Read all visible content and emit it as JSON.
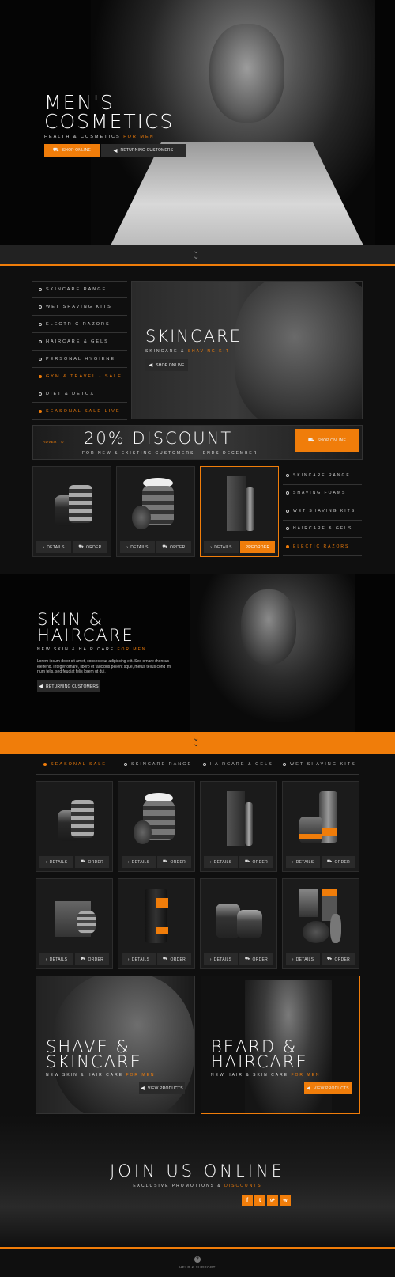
{
  "hero": {
    "title_line1": "MEN'S",
    "title_line2": "COSMETICS",
    "subtitle": "HEALTH & COSMETICS",
    "subtitle_accent": "FOR MEN",
    "btn_shop": "SHOP ONLINE",
    "btn_returning": "RETURNING CUSTOMERS"
  },
  "sidebar": {
    "items": [
      {
        "label": "SKINCARE RANGE",
        "active": false
      },
      {
        "label": "WET SHAVING KITS",
        "active": false
      },
      {
        "label": "ELECTRIC RAZORS",
        "active": false
      },
      {
        "label": "HAIRCARE & GELS",
        "active": false
      },
      {
        "label": "PERSONAL HYGIENE",
        "active": false
      },
      {
        "label": "GYM & TRAVEL - SALE",
        "active": true
      },
      {
        "label": "DIET & DETOX",
        "active": false
      },
      {
        "label": "SEASONAL SALE LIVE",
        "active": true
      }
    ]
  },
  "skincare": {
    "title": "SKINCARE",
    "subtitle": "SKINCARE &",
    "subtitle_accent": "SHAVING KIT",
    "btn": "SHOP ONLINE"
  },
  "discount": {
    "tag": "ADVERT",
    "title": "20% DISCOUNT",
    "subtitle": "FOR NEW & EXISTING CUSTOMERS - ENDS DECEMBER",
    "btn": "SHOP ONLINE"
  },
  "cards_top": [
    {
      "details": "DETAILS",
      "action": "ORDER",
      "highlight": false
    },
    {
      "details": "DETAILS",
      "action": "ORDER",
      "highlight": false
    },
    {
      "details": "DETAILS",
      "action": "PREORDER",
      "highlight": true
    }
  ],
  "side_list": [
    {
      "label": "SKINCARE RANGE",
      "active": false
    },
    {
      "label": "SHAVING FOAMS",
      "active": false
    },
    {
      "label": "WET SHAVING KITS",
      "active": false
    },
    {
      "label": "HAIRCARE & GELS",
      "active": false
    },
    {
      "label": "ELECTIC RAZORS",
      "active": true
    }
  ],
  "haircare": {
    "title_line1": "SKIN &",
    "title_line2": "HAIRCARE",
    "subtitle": "NEW SKIN & HAIR CARE",
    "subtitle_accent": "FOR MEN",
    "body": "Lorem ipsum dolor sit amet, consectetur adipiscing elit. Sed ornare rhoncus eleifend. Integer ornare, libero et faucibus pellent sque, metus tellus cond im rtum felis, sed feugiat felis lorem ut dui.",
    "btn": "RETURNING CUSTOMERS"
  },
  "tabs": [
    {
      "label": "SEASONAL SALE",
      "active": true
    },
    {
      "label": "SKINCARE RANGE",
      "active": false
    },
    {
      "label": "HAIRCARE & GELS",
      "active": false
    },
    {
      "label": "WET SHAVING KITS",
      "active": false
    }
  ],
  "grid_cards": [
    {
      "details": "DETAILS",
      "action": "ORDER"
    },
    {
      "details": "DETAILS",
      "action": "ORDER"
    },
    {
      "details": "DETAILS",
      "action": "ORDER"
    },
    {
      "details": "DETAILS",
      "action": "ORDER"
    },
    {
      "details": "DETAILS",
      "action": "ORDER"
    },
    {
      "details": "DETAILS",
      "action": "ORDER"
    },
    {
      "details": "DETAILS",
      "action": "ORDER"
    },
    {
      "details": "DETAILS",
      "action": "ORDER"
    }
  ],
  "promo_left": {
    "title_line1": "SHAVE &",
    "title_line2": "SKINCARE",
    "subtitle": "NEW SKIN & HAIR CARE",
    "subtitle_accent": "FOR MEN",
    "btn": "VIEW PRODUCTS"
  },
  "promo_right": {
    "title_line1": "BEARD &",
    "title_line2": "HAIRCARE",
    "subtitle": "NEW HAIR & SKIN CARE",
    "subtitle_accent": "FOR MEN",
    "btn": "VIEW PRODUCTS"
  },
  "join": {
    "title": "JOIN US ONLINE",
    "subtitle": "EXCLUSIVE PROMOTIONS &",
    "subtitle_accent": "DISCOUNTS",
    "social": [
      "f",
      "t",
      "g+",
      "w"
    ]
  },
  "footer": {
    "help": "HELP & SUPPORT"
  },
  "colors": {
    "accent": "#f07d0a",
    "bg": "#0f0f0f"
  }
}
